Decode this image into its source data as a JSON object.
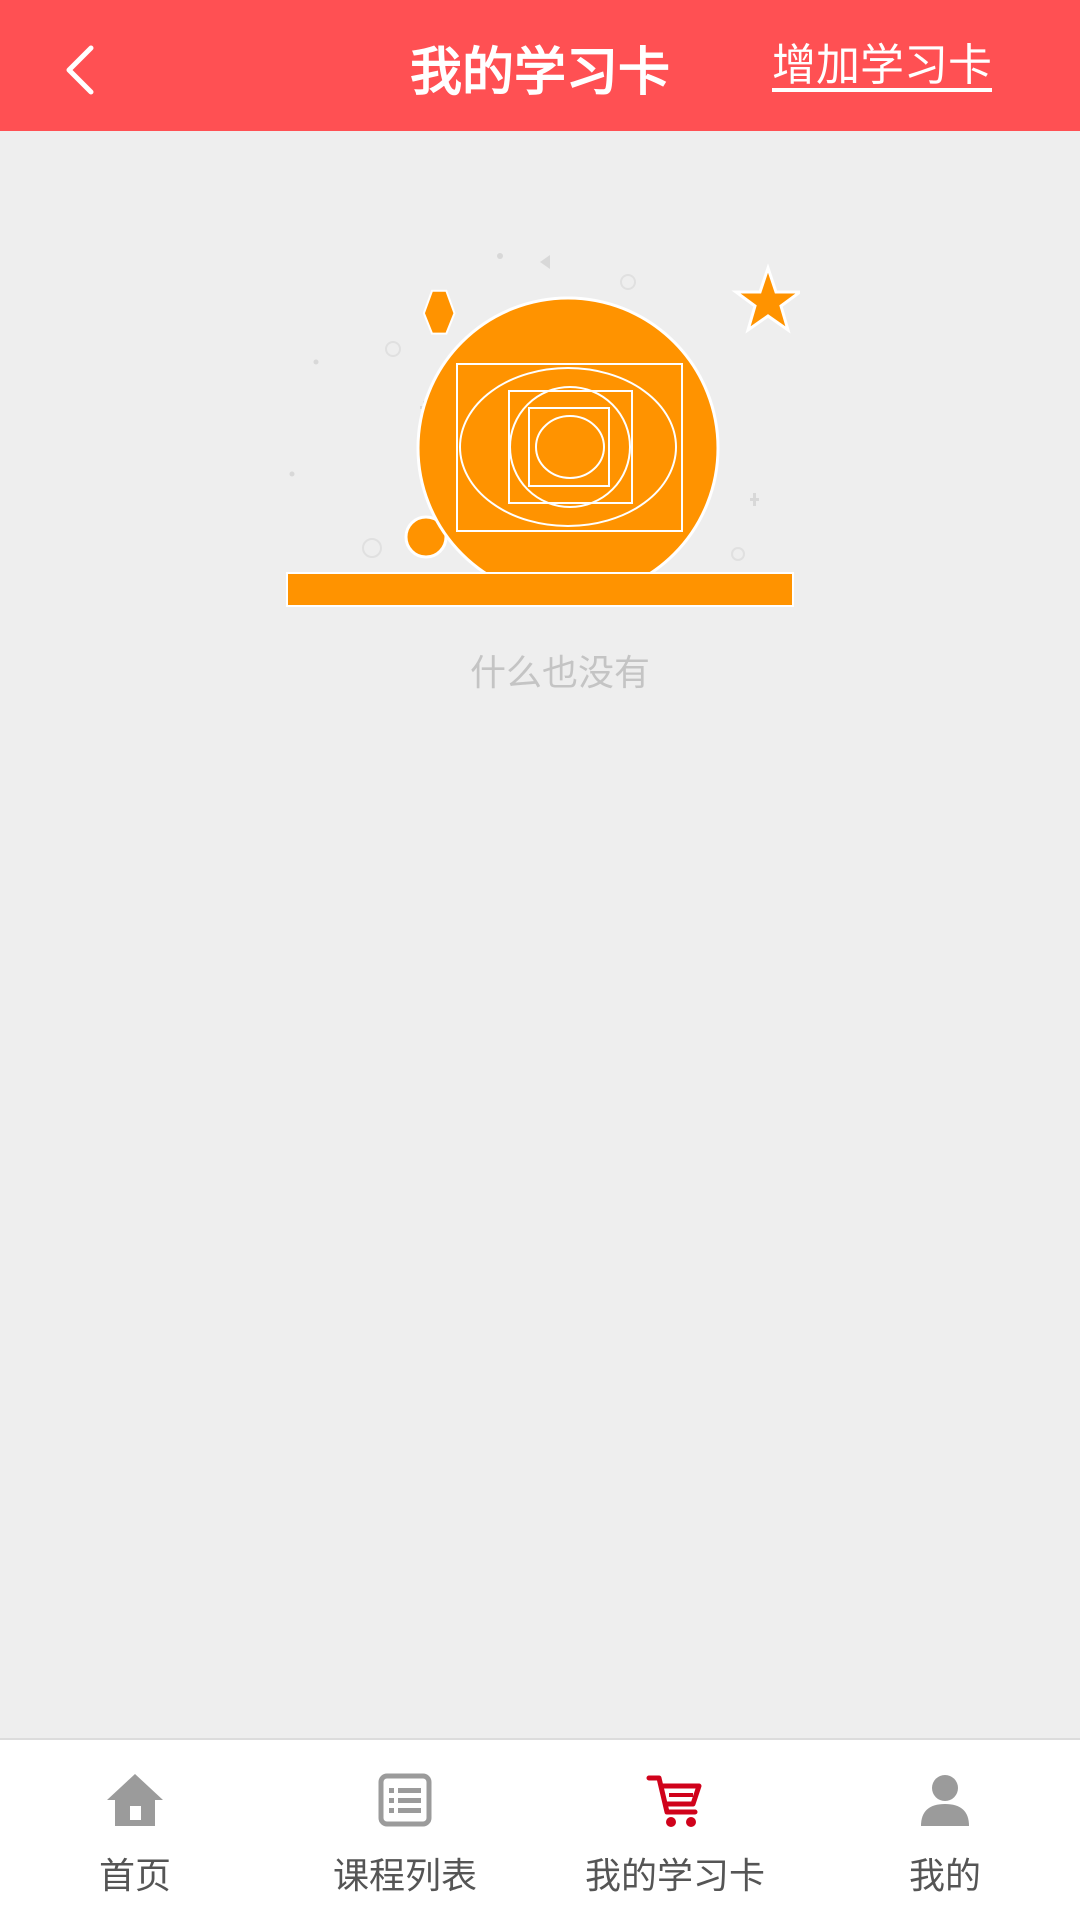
{
  "header": {
    "title": "我的学习卡",
    "add_label": "增加学习卡"
  },
  "empty": {
    "message": "什么也没有"
  },
  "tabbar": {
    "active": "my-cards",
    "tabs": [
      {
        "id": "home",
        "label": "首页",
        "icon": "home-icon"
      },
      {
        "id": "courses",
        "label": "课程列表",
        "icon": "list-icon"
      },
      {
        "id": "my-cards",
        "label": "我的学习卡",
        "icon": "cart-icon"
      },
      {
        "id": "me",
        "label": "我的",
        "icon": "user-icon"
      }
    ]
  },
  "colors": {
    "header_bg": "#ff5053",
    "accent_orange": "#ff9300",
    "active_tab": "#d0021b",
    "inactive_tab_icon": "#9b9b9b",
    "background": "#eeeeee"
  }
}
